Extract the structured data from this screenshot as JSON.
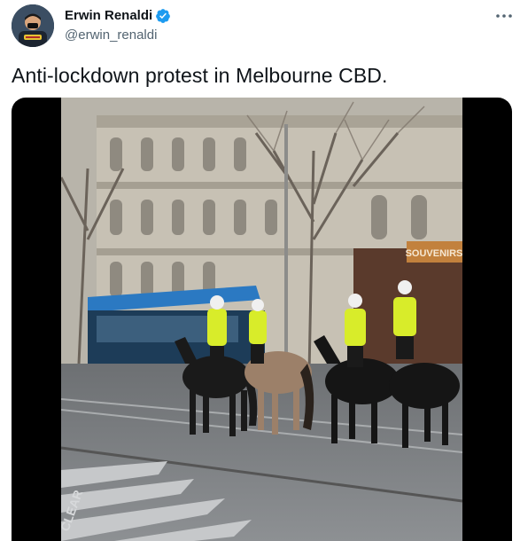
{
  "tweet": {
    "author": {
      "display_name": "Erwin Renaldi",
      "handle": "@erwin_renaldi",
      "verified": true,
      "avatar_icon": "user-avatar"
    },
    "more_icon": "more-horizontal-icon",
    "text": "Anti-lockdown protest in Melbourne CBD.",
    "media": {
      "type": "video",
      "scene": {
        "shop_sign": "SOUVENIRS",
        "road_marking": "CLEAR"
      }
    }
  },
  "colors": {
    "text_primary": "#0f1419",
    "text_secondary": "#536471",
    "verified_blue": "#1d9bf0",
    "police_hivis": "#d8ec2a"
  }
}
